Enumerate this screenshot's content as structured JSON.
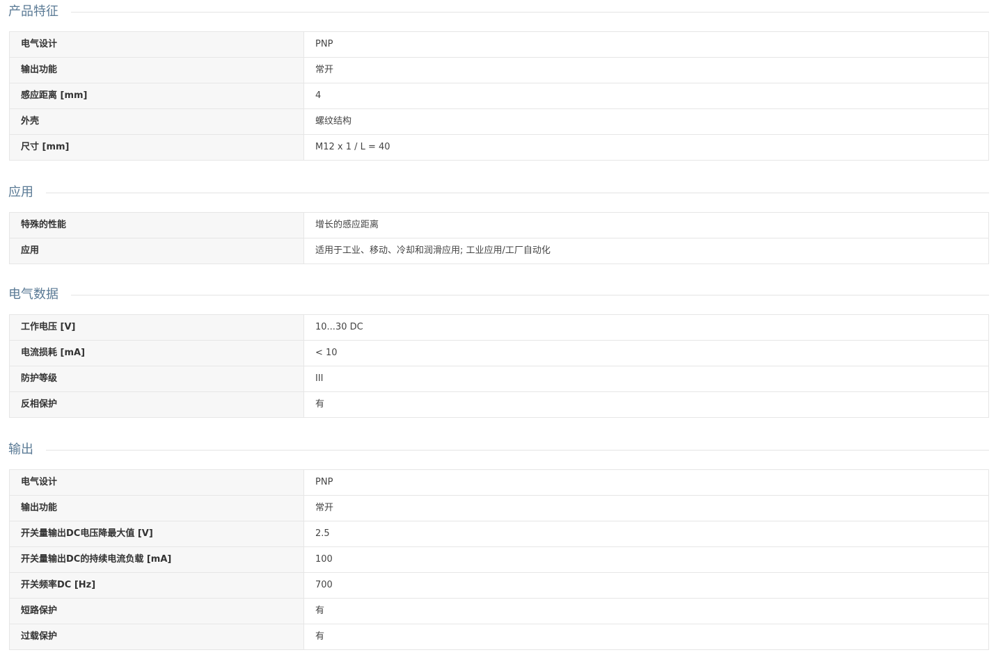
{
  "sections": [
    {
      "title": "产品特征",
      "rows": [
        {
          "label": "电气设计",
          "value": "PNP"
        },
        {
          "label": "输出功能",
          "value": "常开"
        },
        {
          "label": "感应距离 [mm]",
          "value": "4"
        },
        {
          "label": "外壳",
          "value": "螺纹结构"
        },
        {
          "label": "尺寸 [mm]",
          "value": "M12 x 1 / L = 40"
        }
      ]
    },
    {
      "title": "应用",
      "rows": [
        {
          "label": "特殊的性能",
          "value": "增长的感应距离"
        },
        {
          "label": "应用",
          "value": "适用于工业、移动、冷却和润滑应用; 工业应用/工厂自动化"
        }
      ]
    },
    {
      "title": "电气数据",
      "rows": [
        {
          "label": "工作电压 [V]",
          "value": "10...30 DC"
        },
        {
          "label": "电流损耗 [mA]",
          "value": "< 10"
        },
        {
          "label": "防护等级",
          "value": "III"
        },
        {
          "label": "反相保护",
          "value": "有"
        }
      ]
    },
    {
      "title": "输出",
      "rows": [
        {
          "label": "电气设计",
          "value": "PNP"
        },
        {
          "label": "输出功能",
          "value": "常开"
        },
        {
          "label": "开关量输出DC电压降最大值 [V]",
          "value": "2.5"
        },
        {
          "label": "开关量输出DC的持续电流负载 [mA]",
          "value": "100"
        },
        {
          "label": "开关频率DC [Hz]",
          "value": "700"
        },
        {
          "label": "短路保护",
          "value": "有"
        },
        {
          "label": "过载保护",
          "value": "有"
        }
      ]
    }
  ]
}
